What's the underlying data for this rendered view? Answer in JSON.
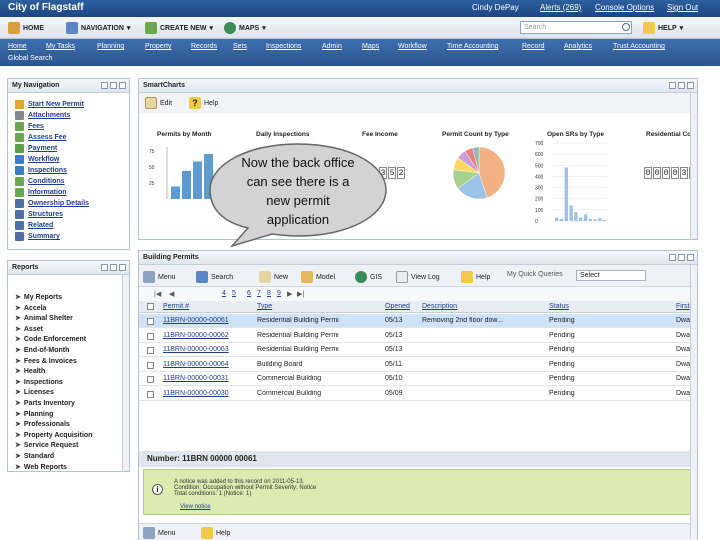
{
  "topbar": {
    "title": "City of Flagstaff",
    "user": "Cindy DePay",
    "alerts": "Alerts (269)",
    "console_options": "Console Options",
    "sign_out": "Sign Out"
  },
  "toolbar": {
    "home": "HOME",
    "navigation": "NAVIGATION",
    "create_new": "CREATE NEW",
    "maps": "MAPS",
    "search_placeholder": "Search",
    "help": "HELP"
  },
  "nav_tabs": [
    "Home",
    "My Tasks",
    "Planning",
    "Property",
    "Records",
    "Sets",
    "Inspections",
    "Admin",
    "Maps",
    "Workflow",
    "Time Accounting",
    "Record",
    "Analytics",
    "Trust Accounting"
  ],
  "global_search": "Global Search",
  "my_navigation": {
    "title": "My Navigation",
    "items": [
      "Start New Permit",
      "Attachments",
      "Fees",
      "Assess Fee",
      "Payment",
      "Workflow",
      "Inspections",
      "Conditions",
      "Information",
      "Ownership Details",
      "Structures",
      "Related",
      "Summary"
    ]
  },
  "reports": {
    "title": "Reports",
    "items": [
      "My Reports",
      "Accela",
      "Animal Shelter",
      "Asset",
      "Code Enforcement",
      "End-of-Month",
      "Fees & Invoices",
      "Health",
      "Inspections",
      "Licenses",
      "Parts Inventory",
      "Planning",
      "Professionals",
      "Property Acquisition",
      "Service Request",
      "Standard",
      "Web Reports"
    ]
  },
  "smart_charts": {
    "title": "SmartCharts",
    "edit": "Edit",
    "help": "Help",
    "charts": [
      "Permits by Month",
      "Daily Inspections",
      "Fee Income",
      "Permit Count by Type",
      "Open SRs by Type",
      "Residential Co"
    ],
    "fee_counter": "352",
    "residential_counter": "000032",
    "open_srs_ticks": [
      "700",
      "600",
      "500",
      "400",
      "300",
      "200",
      "100",
      "0"
    ],
    "permits_ticks": [
      "75",
      "50",
      "25"
    ]
  },
  "chart_data": [
    {
      "type": "bar",
      "title": "Permits by Month",
      "series": [
        {
          "values": [
            20,
            45,
            60,
            72,
            30
          ]
        }
      ],
      "ylim": [
        0,
        80
      ]
    },
    {
      "type": "bar",
      "title": "Open SRs by Type",
      "series": [
        {
          "values": [
            30,
            20,
            480,
            140,
            80,
            30,
            60,
            20,
            15,
            25,
            10
          ]
        }
      ],
      "ylim": [
        0,
        700
      ]
    },
    {
      "type": "pie",
      "title": "Permit Count by Type",
      "values": [
        45,
        20,
        12,
        8,
        6,
        5,
        4
      ]
    }
  ],
  "building_permits": {
    "title": "Building Permits",
    "toolbar": [
      "Menu",
      "Search",
      "New",
      "Model",
      "GIS",
      "View Log",
      "Help"
    ],
    "quick_queries_label": "My Quick Queries",
    "quick_queries_value": "Select",
    "pager": [
      "4",
      "5",
      "6",
      "7",
      "8",
      "9"
    ],
    "columns": [
      "Permit #",
      "Type",
      "Opened",
      "Description",
      "Status",
      "First"
    ],
    "rows": [
      {
        "permit": "11BRN-00000-00061",
        "type": "Residential Building Permi",
        "opened": "05/13",
        "desc": "Removing 2nd floor dow...",
        "status": "Pending",
        "first": "Dwayn"
      },
      {
        "permit": "11BRN-00000-00062",
        "type": "Residential Building Permi",
        "opened": "05/13",
        "desc": "",
        "status": "Pending",
        "first": "Dwayn"
      },
      {
        "permit": "11BRN-00000-00063",
        "type": "Residential Building Permi",
        "opened": "05/13",
        "desc": "",
        "status": "Pending",
        "first": "Dwayn"
      },
      {
        "permit": "11BRN-00000-00064",
        "type": "Building Board",
        "opened": "05/11",
        "desc": "",
        "status": "Pending",
        "first": "Dwayn"
      },
      {
        "permit": "11BRN-00000-00031",
        "type": "Commercial Building",
        "opened": "05/10",
        "desc": "",
        "status": "Pending",
        "first": "Dwayn"
      },
      {
        "permit": "11BRN-00000-00030",
        "type": "Commercial Building",
        "opened": "05/09",
        "desc": "",
        "status": "Pending",
        "first": "Dwayn"
      }
    ],
    "number_label": "Number: 11BRN 00000 00061",
    "notice_lines": [
      "A notice was added to this record on 2011-05-13.",
      "Condition: Occupation without Permit Severity: Notice",
      "Total conditions: 1  (Notice: 1)"
    ],
    "view_notice": "View notice",
    "bottom_menu": "Menu",
    "bottom_help": "Help"
  },
  "callout": "Now the back office can see there is a new permit application"
}
